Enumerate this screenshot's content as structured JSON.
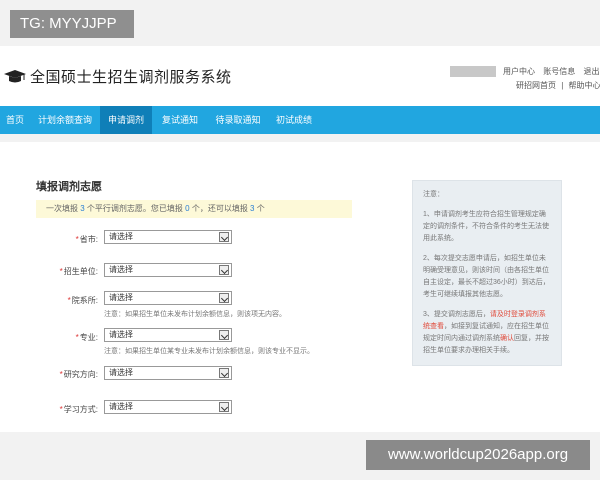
{
  "overlay": {
    "tg_badge": "TG: MYYJJPP",
    "watermark": "www.worldcup2026app.org"
  },
  "header": {
    "title": "全国硕士生招生调剂服务系统",
    "logo_icon": "graduation-cap-icon",
    "links": [
      "用户中心",
      "账号信息",
      "退出"
    ],
    "links2": [
      "研招网首页",
      "|",
      "帮助中心"
    ]
  },
  "nav": {
    "items": [
      {
        "label": "首页",
        "active": false
      },
      {
        "label": "计划余额查询",
        "active": false
      },
      {
        "label": "申请调剂",
        "active": true
      },
      {
        "label": "复试通知",
        "active": false
      },
      {
        "label": "待录取通知",
        "active": false
      },
      {
        "label": "初试成绩",
        "active": false
      }
    ],
    "color": "#21a6e0",
    "active_color": "#0f7fb8"
  },
  "form": {
    "title": "填报调剂志愿",
    "notice_parts": [
      "一次填报 ",
      "3",
      " 个平行调剂志愿。您已填报 ",
      "0",
      " 个，还可以填报 ",
      "3",
      " 个"
    ],
    "fields": [
      {
        "label": "省市:",
        "value": "请选择"
      },
      {
        "label": "招生单位:",
        "value": "请选择"
      },
      {
        "label": "院系所:",
        "value": "请选择",
        "hint": "注意：如果招生单位未发布计划余额信息，则该项无内容。"
      },
      {
        "label": "专业:",
        "value": "请选择",
        "hint": "注意：如果招生单位某专业未发布计划余额信息，则该专业不显示。"
      },
      {
        "label": "研究方向:",
        "value": "请选择"
      },
      {
        "label": "学习方式:",
        "value": "请选择"
      }
    ]
  },
  "side_note": {
    "heading": "注意：",
    "p1": "1、申请调剂考生应符合招生管理规定确定的调剂条件，不符合条件的考生无法使用此系统。",
    "p2": "2、每次提交志愿申请后，如招生单位未明确受理意见，则该时间（由各招生单位自主设定，最长不超过36小时）到达后，考生可继续填报其他志愿。",
    "p3_before": "3、提交调剂志愿后，",
    "p3_red1": "请及时登录调剂系统查看",
    "p3_mid": "，如接到复试通知，应在招生单位规定时间内通过调剂系统",
    "p3_red2": "确认",
    "p3_after": "回复，并按招生单位要求办理相关手续。"
  }
}
